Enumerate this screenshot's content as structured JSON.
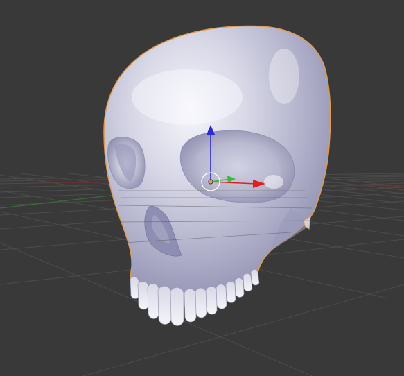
{
  "viewport": {
    "background_color": "#393939",
    "grid_color": "#4a4a4a",
    "axis_x_color": "#7a2f2f",
    "axis_y_color": "#3e6a3e",
    "selection_outline_color": "#e39a45"
  },
  "object": {
    "type": "mesh",
    "icon": "skull-mesh",
    "selected": true,
    "material_color": "#c8c8dc"
  },
  "gizmo": {
    "type": "translate",
    "x_axis_color": "#e02020",
    "y_axis_color": "#2ec02e",
    "z_axis_color": "#2a2ae0",
    "origin_color": "#e39a45"
  }
}
